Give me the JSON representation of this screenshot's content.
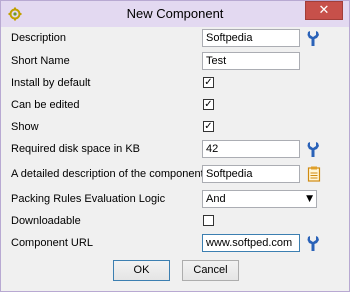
{
  "window": {
    "title": "New Component",
    "close_glyph": "✕"
  },
  "form": {
    "description": {
      "label": "Description",
      "value": "Softpedia"
    },
    "short_name": {
      "label": "Short Name",
      "value": "Test"
    },
    "install_by_default": {
      "label": "Install by default",
      "checked": true
    },
    "can_be_edited": {
      "label": "Can be edited",
      "checked": true
    },
    "show": {
      "label": "Show",
      "checked": true
    },
    "disk_space": {
      "label": "Required disk space in KB",
      "value": "42"
    },
    "detailed_description": {
      "label": "A detailed description of the component",
      "value": "Softpedia"
    },
    "packing_rules": {
      "label": "Packing Rules Evaluation Logic",
      "value": "And"
    },
    "downloadable": {
      "label": "Downloadable",
      "checked": false
    },
    "component_url": {
      "label": "Component URL",
      "value": "www.softped.com"
    }
  },
  "buttons": {
    "ok_label": "OK",
    "cancel_label": "Cancel"
  },
  "icons": {
    "wrench": "wrench-icon",
    "notes": "notepad-icon",
    "app": "gear-app-icon"
  },
  "colors": {
    "titlebar": "#e3d9f1",
    "close": "#c7504a",
    "wrench": "#2a62b8",
    "notes": "#e0a02a"
  }
}
